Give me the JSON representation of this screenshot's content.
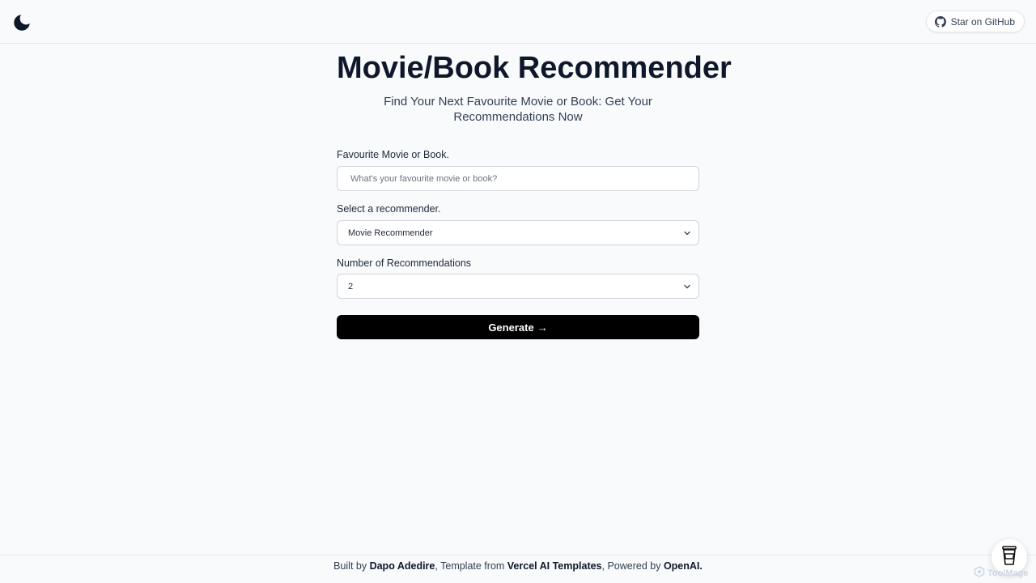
{
  "header": {
    "theme_toggle_icon": "moon-icon",
    "github_button": {
      "label": "Star on GitHub",
      "icon": "github-icon"
    }
  },
  "main": {
    "title": "Movie/Book Recommender",
    "subtitle": "Find Your Next Favourite Movie or Book: Get Your Recommendations Now",
    "favourite_field": {
      "label": "Favourite Movie or Book.",
      "value": "",
      "placeholder": "What's your favourite movie or book?"
    },
    "recommender_field": {
      "label": "Select a recommender.",
      "selected": "Movie Recommender",
      "icon": "chevron-down-icon"
    },
    "count_field": {
      "label": "Number of Recommendations",
      "selected": "2",
      "icon": "chevron-down-icon"
    },
    "generate_button": {
      "label": "Generate",
      "arrow": "→"
    }
  },
  "footer": {
    "built_by_prefix": "Built by ",
    "author": "Dapo Adedire",
    "template_prefix": ", Template from ",
    "template_name": "Vercel AI Templates",
    "powered_prefix": ", Powered by ",
    "powered_name": "OpenAI."
  },
  "floating": {
    "coffee_icon": "coffee-cup-icon",
    "watermark_text": "ToolMage"
  },
  "colors": {
    "background": "#f8fafc",
    "primary_button": "#000000",
    "text": "#0f172a"
  }
}
